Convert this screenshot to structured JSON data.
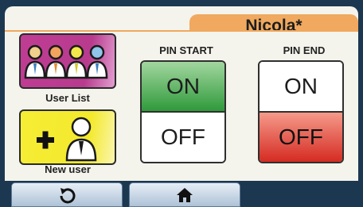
{
  "header": {
    "user_name": "Nicola*"
  },
  "left_buttons": {
    "user_list_label": "User List",
    "new_user_label": "New user"
  },
  "pin_start": {
    "label": "PIN START",
    "on": "ON",
    "off": "OFF",
    "active": "ON"
  },
  "pin_end": {
    "label": "PIN END",
    "on": "ON",
    "off": "OFF",
    "active": "OFF"
  },
  "nav": {
    "back_icon": "undo-arrow-icon",
    "home_icon": "home-icon"
  },
  "colors": {
    "user_list_bg": "#bf3d93",
    "new_user_bg": "#f6ee35",
    "on_active": "#2f9a3b",
    "off_active": "#d52b22",
    "tab": "#f0a95e",
    "frame": "#1c3750"
  }
}
